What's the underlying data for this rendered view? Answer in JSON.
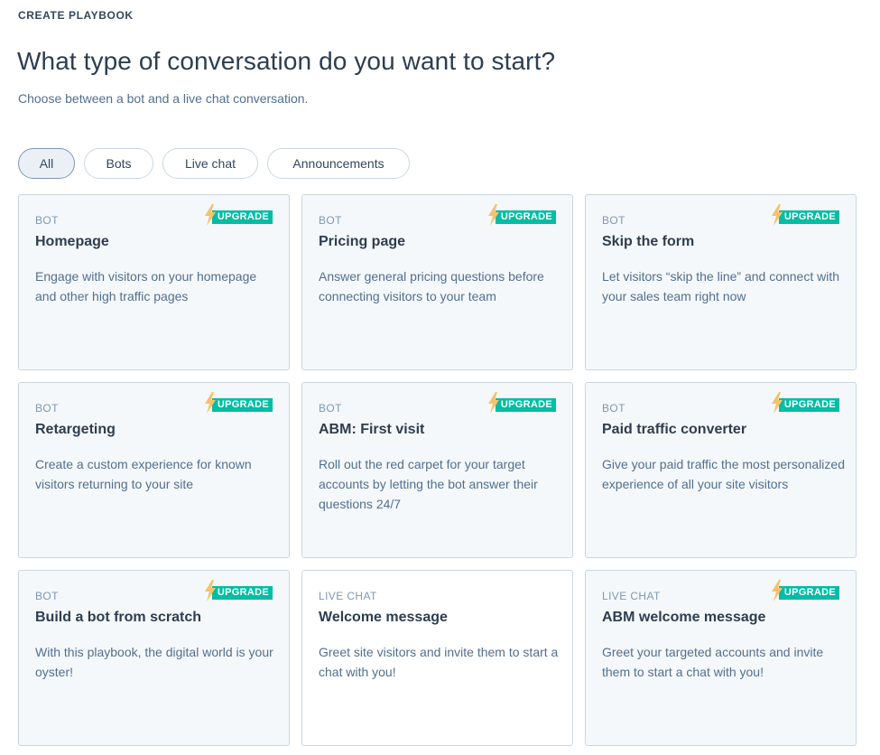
{
  "header": {
    "eyebrow": "CREATE PLAYBOOK",
    "title": "What type of conversation do you want to start?",
    "subtitle": "Choose between a bot and a live chat conversation."
  },
  "filters": {
    "all": "All",
    "bots": "Bots",
    "live_chat": "Live chat",
    "announcements": "Announcements",
    "selected": "All"
  },
  "badge_label": "UPGRADE",
  "colors": {
    "accent": "#00bda5",
    "bolt": "#f5c26b",
    "card_bg": "#f5f8fa",
    "border": "#cbd6e2"
  },
  "cards": [
    {
      "kind": "BOT",
      "name": "Homepage",
      "desc": "Engage with visitors on your homepage and other high traffic pages",
      "upgrade": true
    },
    {
      "kind": "BOT",
      "name": "Pricing page",
      "desc": "Answer general pricing questions before connecting visitors to your team",
      "upgrade": true
    },
    {
      "kind": "BOT",
      "name": "Skip the form",
      "desc": "Let visitors “skip the line” and connect with your sales team right now",
      "upgrade": true
    },
    {
      "kind": "BOT",
      "name": "Retargeting",
      "desc": "Create a custom experience for known visitors returning to your site",
      "upgrade": true
    },
    {
      "kind": "BOT",
      "name": "ABM: First visit",
      "desc": "Roll out the red carpet for your target accounts by letting the bot answer their questions 24/7",
      "upgrade": true
    },
    {
      "kind": "BOT",
      "name": "Paid traffic converter",
      "desc": "Give your paid traffic the most personalized experience of all your site visitors",
      "upgrade": true
    },
    {
      "kind": "BOT",
      "name": "Build a bot from scratch",
      "desc": "With this playbook, the digital world is your oyster!",
      "upgrade": true
    },
    {
      "kind": "LIVE CHAT",
      "name": "Welcome message",
      "desc": "Greet site visitors and invite them to start a chat with you!",
      "upgrade": false
    },
    {
      "kind": "LIVE CHAT",
      "name": "ABM welcome message",
      "desc": "Greet your targeted accounts and invite them to start a chat with you!",
      "upgrade": true
    }
  ]
}
